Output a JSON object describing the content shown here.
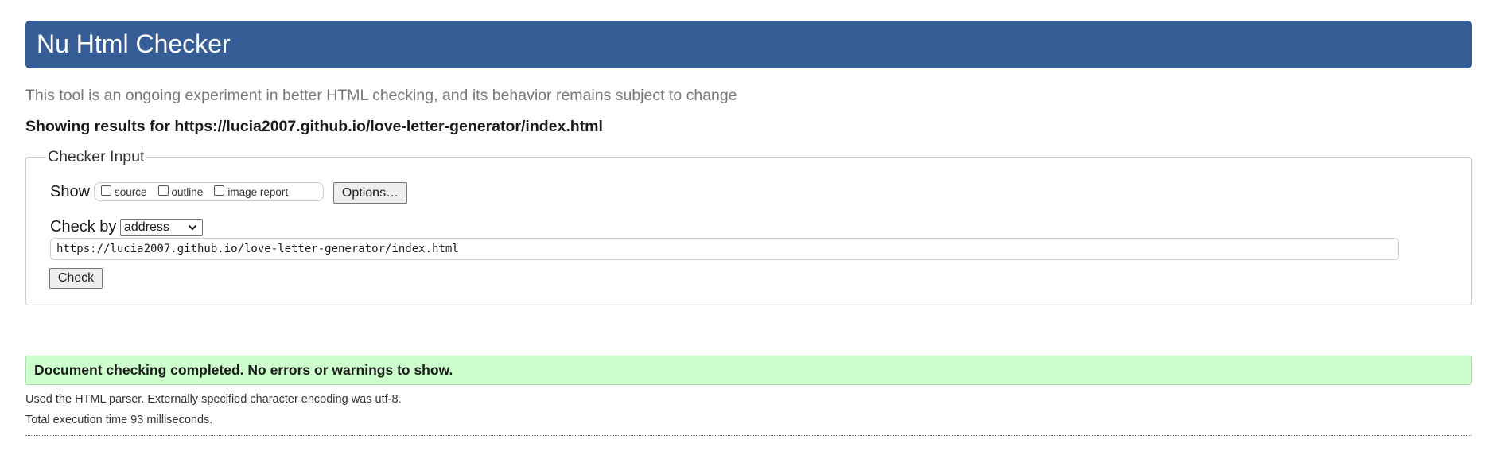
{
  "header": {
    "title": "Nu Html Checker"
  },
  "subtitle": "This tool is an ongoing experiment in better HTML checking, and its behavior remains subject to change",
  "results_for": "Showing results for https://lucia2007.github.io/love-letter-generator/index.html",
  "checker_input": {
    "legend": "Checker Input",
    "show_label": "Show",
    "checkboxes": [
      {
        "label": "source",
        "checked": false
      },
      {
        "label": "outline",
        "checked": false
      },
      {
        "label": "image report",
        "checked": false
      }
    ],
    "options_label": "Options…",
    "check_by_label": "Check by",
    "check_by_value": "address",
    "url_value": "https://lucia2007.github.io/love-letter-generator/index.html",
    "check_label": "Check"
  },
  "result": {
    "message": "Document checking completed. No errors or warnings to show.",
    "details": [
      "Used the HTML parser. Externally specified character encoding was utf-8.",
      "Total execution time 93 milliseconds."
    ]
  },
  "colors": {
    "header_bg": "#365d95",
    "success_bg": "#ccffcc",
    "subtitle_text": "#777777"
  },
  "icons": {
    "select_chevron": "chevron-down-icon"
  }
}
